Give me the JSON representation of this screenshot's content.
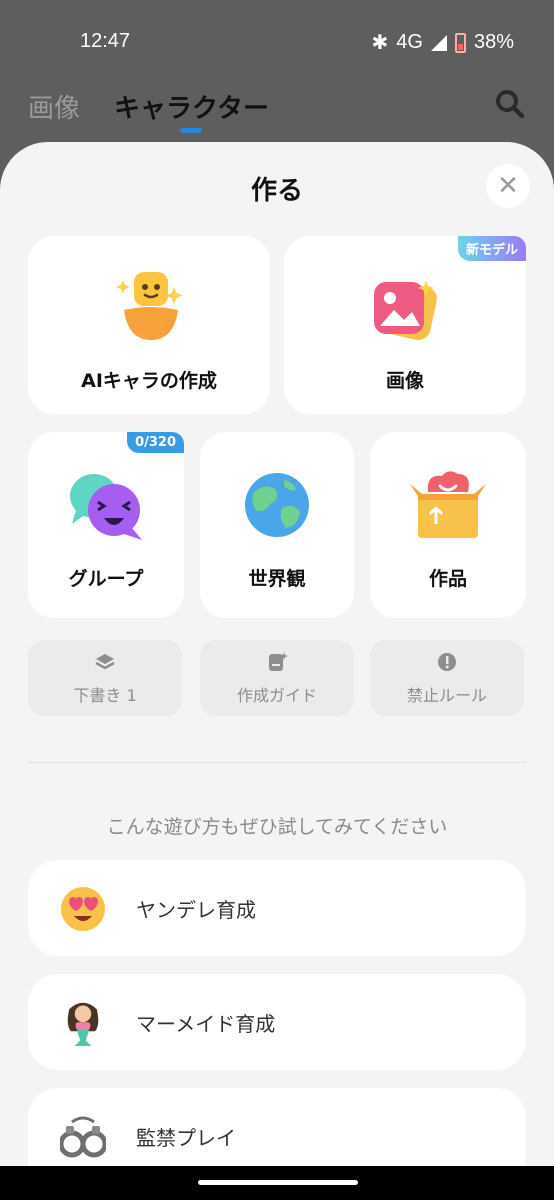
{
  "status": {
    "time": "12:47",
    "network": "4G",
    "battery": "38%"
  },
  "tabs": [
    {
      "label": "画像"
    },
    {
      "label": "キャラクター"
    }
  ],
  "sheet": {
    "title": "作る",
    "close": "✕"
  },
  "create_cards": [
    {
      "label": "AIキャラの作成"
    },
    {
      "label": "画像",
      "badge": "新モデル"
    },
    {
      "label": "グループ",
      "badge": "0/320"
    },
    {
      "label": "世界観"
    },
    {
      "label": "作品"
    }
  ],
  "utilities": [
    {
      "label": "下書き 1",
      "icon": "layers-icon"
    },
    {
      "label": "作成ガイド",
      "icon": "guide-icon"
    },
    {
      "label": "禁止ルール",
      "icon": "warning-icon"
    }
  ],
  "suggest_heading": "こんな遊び方もぜひ試してみてください",
  "suggestions": [
    {
      "label": "ヤンデレ育成",
      "icon": "heart-eyes-icon"
    },
    {
      "label": "マーメイド育成",
      "icon": "mermaid-icon"
    },
    {
      "label": "監禁プレイ",
      "icon": "handcuffs-icon"
    }
  ]
}
